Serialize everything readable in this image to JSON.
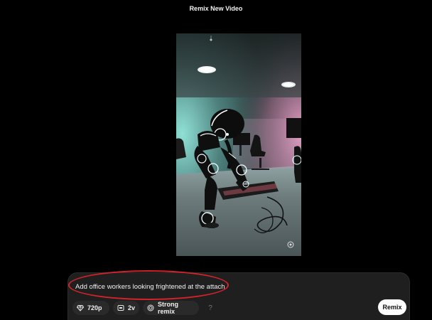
{
  "header": {
    "title": "Remix New Video"
  },
  "prompt": {
    "text": "Add office workers looking frightened at the attach."
  },
  "options": {
    "quality": {
      "label": "720p",
      "icon": "diamond-icon"
    },
    "variations": {
      "label": "2v",
      "icon": "variations-icon"
    },
    "strength": {
      "label": "Strong remix",
      "icon": "remix-strength-icon"
    },
    "help": {
      "label": "?",
      "icon": "help-icon"
    }
  },
  "actions": {
    "remix_label": "Remix"
  },
  "annotation": {
    "color": "#d2232a"
  }
}
